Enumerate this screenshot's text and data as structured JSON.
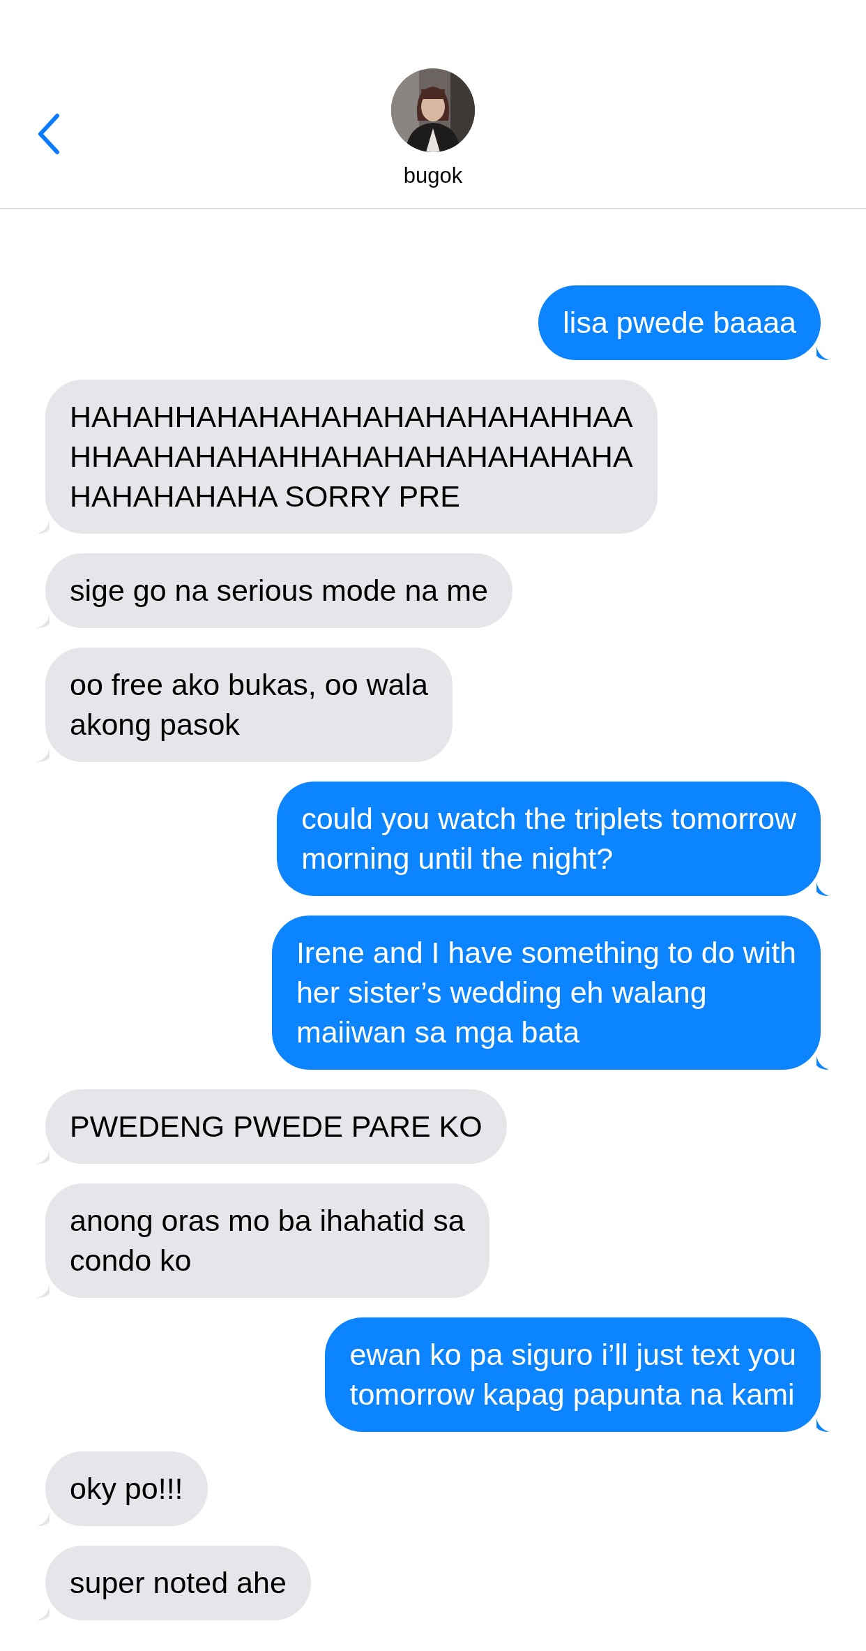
{
  "header": {
    "contact_name": "bugok"
  },
  "messages": [
    {
      "kind": "sent",
      "lines": [
        "lisa pwede baaaa"
      ]
    },
    {
      "kind": "received",
      "lines": [
        "HAHAHHAHAHAHAHAHAHAHAHAHHAA",
        "HHAAHAHAHAHHAHAHAHAHAHAHAHA",
        "HAHAHAHAHA SORRY PRE"
      ]
    },
    {
      "kind": "received",
      "lines": [
        "sige go na serious mode na me"
      ]
    },
    {
      "kind": "received",
      "lines": [
        "oo free ako bukas, oo wala",
        "akong pasok"
      ]
    },
    {
      "kind": "sent",
      "lines": [
        "could you watch the triplets tomorrow",
        "morning until the night?"
      ]
    },
    {
      "kind": "sent",
      "lines": [
        "Irene and I have something to do with",
        "her sister’s wedding eh walang",
        "maiiwan sa mga bata"
      ]
    },
    {
      "kind": "received",
      "lines": [
        "PWEDENG PWEDE PARE KO"
      ]
    },
    {
      "kind": "received",
      "lines": [
        "anong oras mo ba ihahatid sa",
        "condo ko"
      ]
    },
    {
      "kind": "sent",
      "lines": [
        "ewan ko pa siguro i’ll just text you",
        "tomorrow kapag papunta na kami"
      ]
    },
    {
      "kind": "received",
      "lines": [
        "oky po!!!"
      ]
    },
    {
      "kind": "received",
      "lines": [
        "super noted ahe"
      ]
    }
  ]
}
